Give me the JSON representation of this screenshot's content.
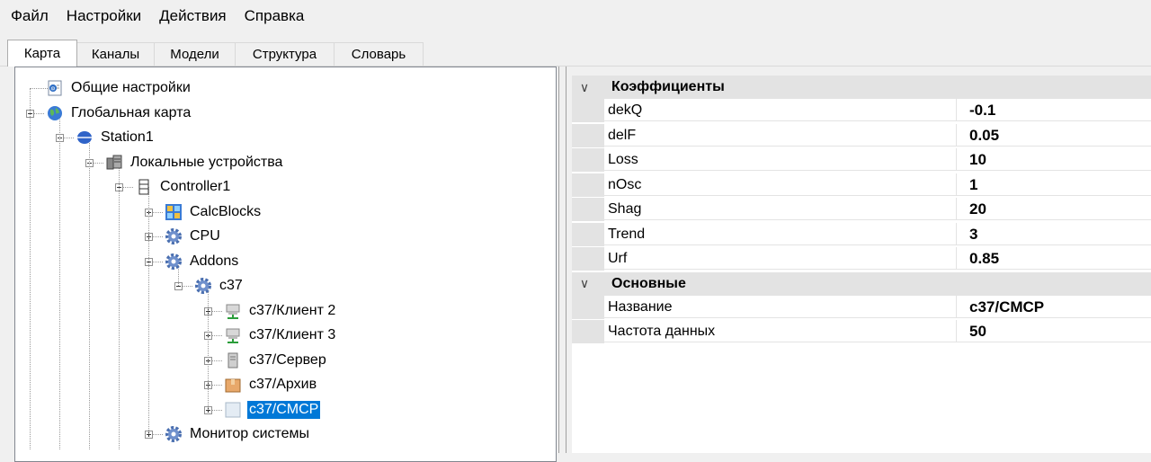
{
  "menu": [
    "Файл",
    "Настройки",
    "Действия",
    "Справка"
  ],
  "tabs": [
    "Карта",
    "Каналы",
    "Модели",
    "Структура",
    "Словарь"
  ],
  "active_tab": "Карта",
  "tree": [
    {
      "label": "Общие настройки",
      "icon": "settings-doc-icon",
      "expander": "none"
    },
    {
      "label": "Глобальная карта",
      "icon": "globe-icon",
      "expander": "minus"
    },
    {
      "label": "Station1",
      "icon": "station-icon",
      "expander": "minus"
    },
    {
      "label": "Локальные устройства",
      "icon": "devices-icon",
      "expander": "minus"
    },
    {
      "label": "Controller1",
      "icon": "server-icon",
      "expander": "minus"
    },
    {
      "label": "CalcBlocks",
      "icon": "calcblocks-icon",
      "expander": "plus"
    },
    {
      "label": "CPU",
      "icon": "gear-icon",
      "expander": "plus"
    },
    {
      "label": "Addons",
      "icon": "gear-icon",
      "expander": "minus"
    },
    {
      "label": "c37",
      "icon": "gear-icon",
      "expander": "minus"
    },
    {
      "label": "c37/Клиент 2",
      "icon": "network-client-icon",
      "expander": "plus"
    },
    {
      "label": "c37/Клиент 3",
      "icon": "network-client-icon",
      "expander": "plus"
    },
    {
      "label": "c37/Сервер",
      "icon": "server-tower-icon",
      "expander": "plus"
    },
    {
      "label": "c37/Архив",
      "icon": "archive-box-icon",
      "expander": "plus"
    },
    {
      "label": "c37/CMCP",
      "icon": "blank-module-icon",
      "expander": "plus",
      "selected": true
    },
    {
      "label": "Монитор системы",
      "icon": "gear-icon",
      "expander": "plus"
    }
  ],
  "properties": [
    {
      "category": "Коэффициенты",
      "rows": [
        {
          "name": "dekQ",
          "value": "-0.1"
        },
        {
          "name": "delF",
          "value": "0.05"
        },
        {
          "name": "Loss",
          "value": "10"
        },
        {
          "name": "nOsc",
          "value": "1"
        },
        {
          "name": "Shag",
          "value": "20"
        },
        {
          "name": "Trend",
          "value": "3"
        },
        {
          "name": "Urf",
          "value": "0.85"
        }
      ]
    },
    {
      "category": "Основные",
      "rows": [
        {
          "name": "Название",
          "value": "c37/CMCP"
        },
        {
          "name": "Частота данных",
          "value": "50"
        }
      ]
    }
  ],
  "colors": {
    "selection": "#0078d7",
    "category_bg": "#e3e3e3"
  }
}
